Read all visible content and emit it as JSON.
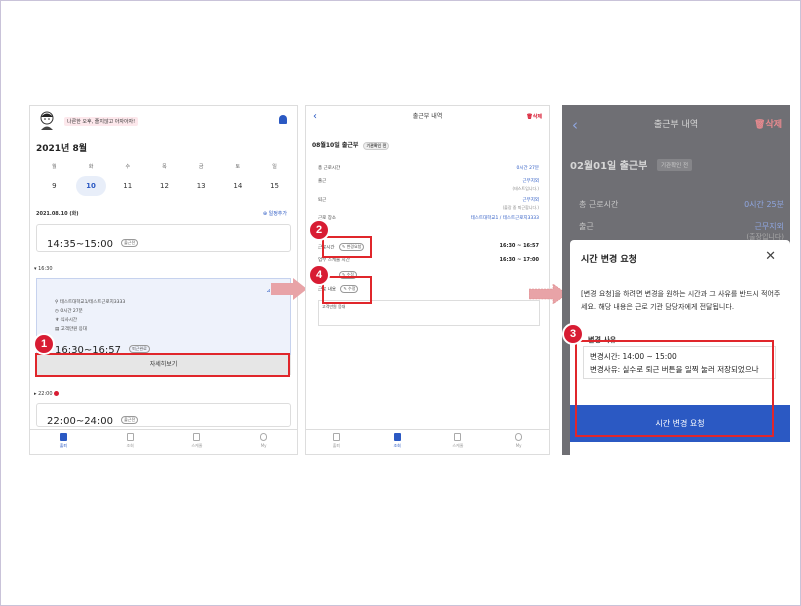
{
  "panel1": {
    "greeting": "나른한 오후, 졸지않고 아자아자!",
    "month": "2021년 8월",
    "weekdays": [
      "월",
      "화",
      "수",
      "목",
      "금",
      "토",
      "일"
    ],
    "dates": [
      "9",
      "10",
      "11",
      "12",
      "13",
      "14",
      "15"
    ],
    "selected_date_index": 1,
    "date_header": "2021.08.10 (화)",
    "date_header_right": "⊕ 일정추가",
    "shift1_time": "14:35~15:00",
    "shift1_chip": "출근전",
    "section1": "▾ 16:30",
    "card_corner": "⊿ 근로지",
    "card_rows": [
      "⚲ 테스트대학교1/테스트근로지3333",
      "◷ 0시간 27분",
      "♆ 식사시간",
      "▤ 고객만원 응대"
    ],
    "shift2_time": "16:30~16:57",
    "shift2_chip": "퇴근완료",
    "detail_button": "자세히보기",
    "section2": "▸ 22:00",
    "shift3_time": "22:00~24:00",
    "shift3_chip": "출근전",
    "nav": [
      "출퇴",
      "조회",
      "스케줄",
      "My"
    ]
  },
  "panel2": {
    "title": "출근부 내역",
    "delete": "삭제",
    "heading": "08월10일 출근부",
    "heading_chip": "기관확인 전",
    "rows": [
      {
        "label": "총 근로시간",
        "value": "0시간 27분",
        "sub": ""
      },
      {
        "label": "출근",
        "value": "근무지외",
        "sub": "(테스트입니다.)"
      },
      {
        "label": "퇴근",
        "value": "근무지외",
        "sub": "(출장 중 퇴근합니다.)"
      },
      {
        "label": "근로 장소",
        "value": "테스트대학교1 / 테스트근로지3333",
        "sub": ""
      }
    ],
    "row_time1_label": "근로시간",
    "row_time1_chip": "✎ 변경요청",
    "row_time1_value": "16:30 ~ 16:57",
    "row_time2_label": "업무 스케줄 시간",
    "row_time2_value": "16:30 ~ 17:00",
    "row_time3_chip": "✎ 수정",
    "row_content_label": "근로 내용",
    "row_content_chip": "✎ 수정",
    "textarea": "고객만원 응대",
    "nav": [
      "출퇴",
      "조회",
      "스케줄",
      "My"
    ]
  },
  "panel3": {
    "title": "출근부 내역",
    "delete": "삭제",
    "heading": "02월01일 출근부",
    "heading_chip": "기관확인 전",
    "row1_label": "총 근로시간",
    "row1_value": "0시간 25분",
    "row2_label": "출근",
    "row2_value": "근무지외",
    "row2_sub": "(출장입니다)",
    "modal_title": "시간 변경 요청",
    "modal_close": "✕",
    "modal_desc": "[변경 요청]을 하려면 변경을 원하는 시간과 그 사유를 반드시 적어주세요. 해당 내용은 근로 기관 담당자에게 전달됩니다.",
    "reason_label": "변경 사유",
    "reason_line1": "변경시간: 14:00 ~ 15:00",
    "reason_line2": "변경사유: 실수로 퇴근 버튼을 일찍 눌러 저장되었으나 15시까지 근로하였음",
    "request_button": "시간 변경 요청"
  },
  "badges": [
    "1",
    "2",
    "3",
    "4"
  ],
  "colors": {
    "accent": "#2b59c3",
    "highlight": "#e0262b",
    "badge": "#d81c33",
    "arrow": "#e8a3a7"
  }
}
